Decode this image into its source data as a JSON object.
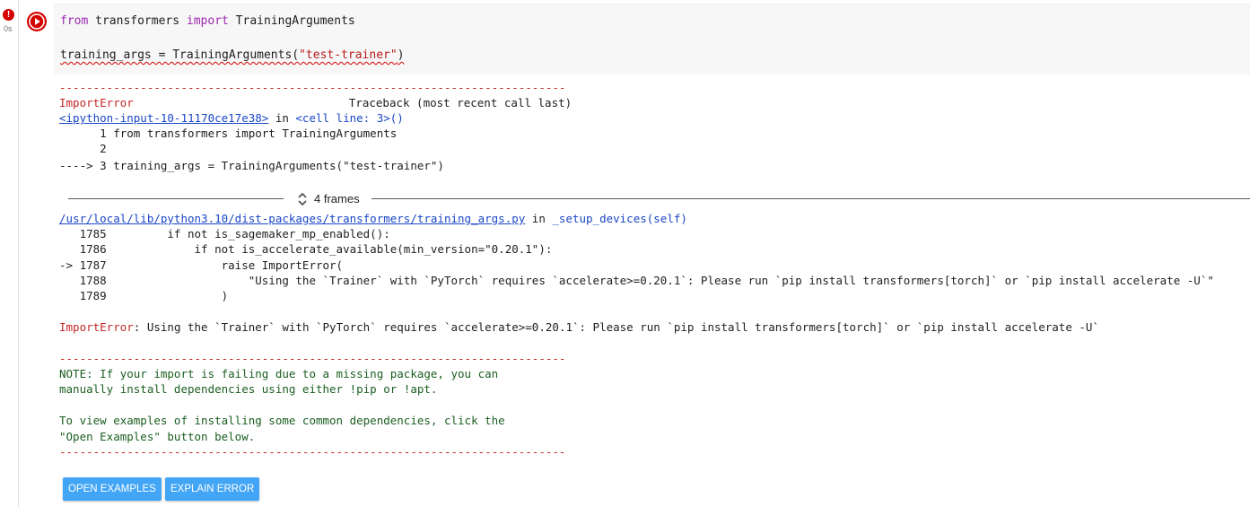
{
  "cell": {
    "error_badge": "!",
    "exec_time": "0s",
    "code": {
      "line1": {
        "kw_from": "from",
        "mod": " transformers ",
        "kw_import": "import",
        "name": " TrainingArguments"
      },
      "line2": {
        "lhs": "training_args = TrainingArguments(",
        "arg": "\"test-trainer\"",
        "close": ")"
      }
    }
  },
  "traceback": {
    "dashes": "---------------------------------------------------------------------------",
    "error_name": "ImportError",
    "header_right": "Traceback (most recent call last)",
    "input_link": "<ipython-input-10-11170ce17e38>",
    "in_word": " in ",
    "cell_line": "<cell line: 3>()",
    "lines1": [
      "      1 from transformers import TrainingArguments",
      "      2 ",
      "----> 3 training_args = TrainingArguments(\"test-trainer\")"
    ],
    "frames_label": "4 frames",
    "file_link": "/usr/local/lib/python3.10/dist-packages/transformers/training_args.py",
    "func": "_setup_devices(self)",
    "lines2": [
      "   1785         if not is_sagemaker_mp_enabled():",
      "   1786             if not is_accelerate_available(min_version=\"0.20.1\"):",
      "-> 1787                 raise ImportError(",
      "   1788                     \"Using the `Trainer` with `PyTorch` requires `accelerate>=0.20.1`: Please run `pip install transformers[torch]` or `pip install accelerate -U`\"",
      "   1789                 )"
    ],
    "final_error_name": "ImportError",
    "final_error_msg": ": Using the `Trainer` with `PyTorch` requires `accelerate>=0.20.1`: Please run `pip install transformers[torch]` or `pip install accelerate -U`"
  },
  "note": {
    "lines": [
      "NOTE: If your import is failing due to a missing package, you can",
      "manually install dependencies using either !pip or !apt.",
      "",
      "To view examples of installing some common dependencies, click the",
      "\"Open Examples\" button below."
    ]
  },
  "buttons": {
    "open_examples": "OPEN EXAMPLES",
    "explain_error": "EXPLAIN ERROR"
  },
  "colors": {
    "error_red": "#d50000",
    "button_blue": "#42a5f5",
    "keyword_purple": "#9c27b0",
    "note_green": "#1b5e20"
  }
}
